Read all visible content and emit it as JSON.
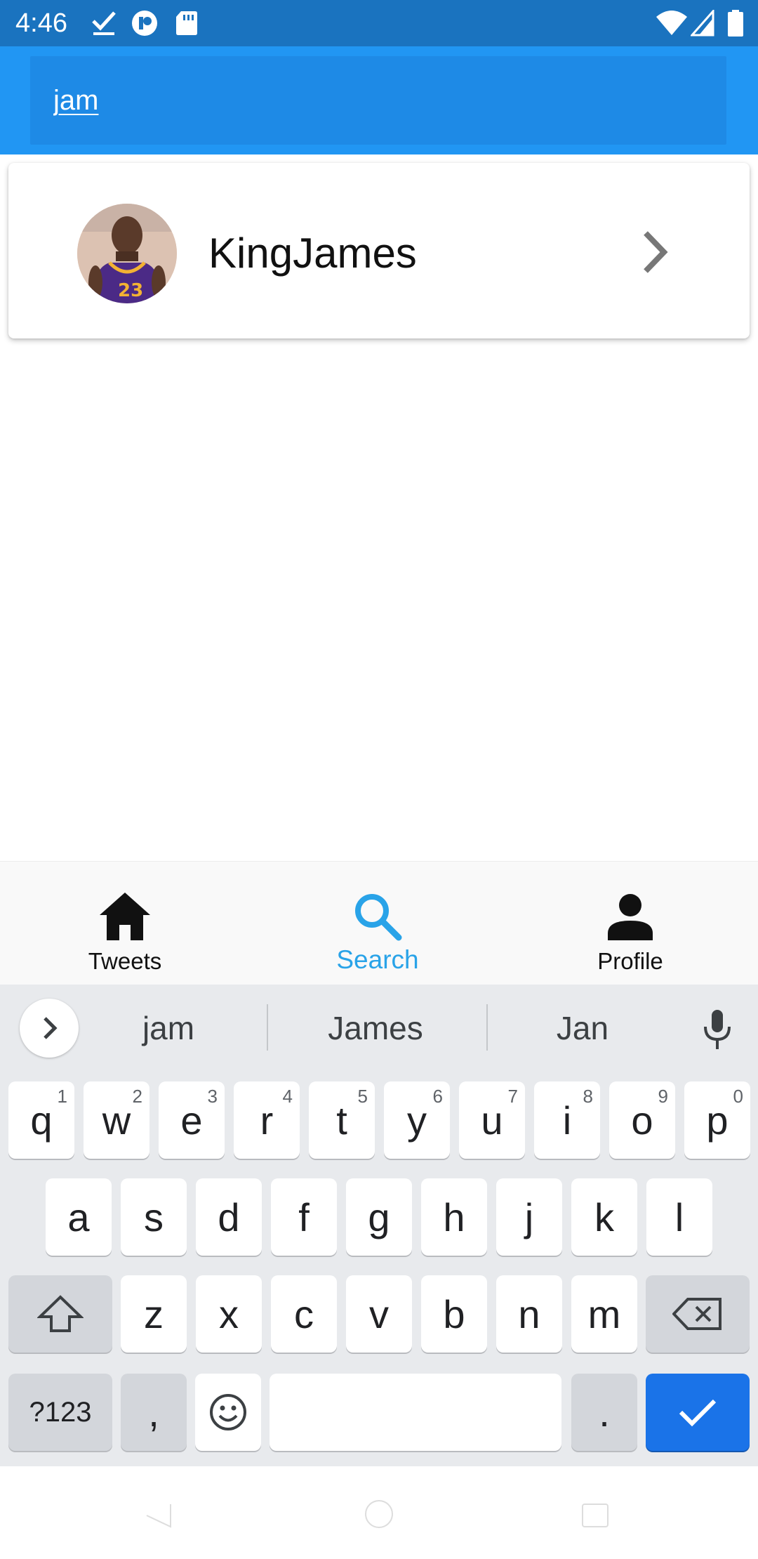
{
  "status_bar": {
    "time": "4:46",
    "left_icons": [
      "download-done-icon",
      "pocket-app-icon",
      "sd-card-icon"
    ],
    "right_icons": [
      "wifi-icon",
      "signal-icon",
      "battery-icon"
    ]
  },
  "search": {
    "value": "jam",
    "placeholder": ""
  },
  "results": [
    {
      "name": "KingJames",
      "avatar": "avatar-photo"
    }
  ],
  "bottom_nav": {
    "items": [
      {
        "label": "Tweets",
        "icon": "home-icon",
        "active": false
      },
      {
        "label": "Search",
        "icon": "search-icon",
        "active": true
      },
      {
        "label": "Profile",
        "icon": "person-icon",
        "active": false
      }
    ],
    "active_color": "#29a3e8"
  },
  "keyboard": {
    "suggestions": [
      "jam",
      "James",
      "Jan"
    ],
    "row1": [
      "q",
      "w",
      "e",
      "r",
      "t",
      "y",
      "u",
      "i",
      "o",
      "p"
    ],
    "row1_hints": [
      "1",
      "2",
      "3",
      "4",
      "5",
      "6",
      "7",
      "8",
      "9",
      "0"
    ],
    "row2": [
      "a",
      "s",
      "d",
      "f",
      "g",
      "h",
      "j",
      "k",
      "l"
    ],
    "row3": [
      "z",
      "x",
      "c",
      "v",
      "b",
      "n",
      "m"
    ],
    "symbols_label": "?123",
    "comma": ",",
    "period": ".",
    "enter_color": "#1a73e8"
  },
  "colors": {
    "status_bar": "#1a73bf",
    "app_bar": "#2196f3",
    "search_field": "#1e8ae6"
  }
}
